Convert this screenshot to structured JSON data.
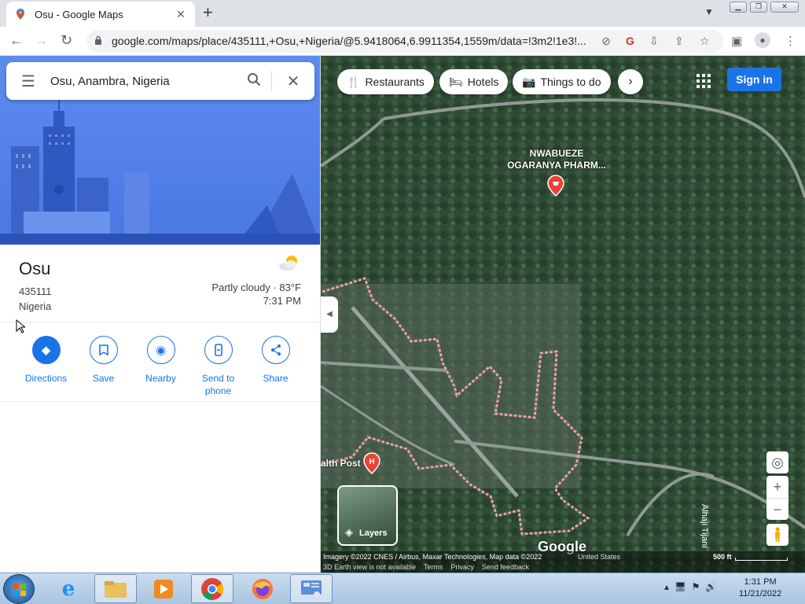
{
  "browser": {
    "tab_title": "Osu - Google Maps",
    "tab_close": "✕",
    "new_tab": "+",
    "url": "google.com/maps/place/435111,+Osu,+Nigeria/@5.9418064,6.9911354,1559m/data=!3m2!1e3!..."
  },
  "search": {
    "query": "Osu, Anambra, Nigeria"
  },
  "place": {
    "name": "Osu",
    "postal_code": "435111",
    "country": "Nigeria"
  },
  "weather": {
    "condition": "Partly cloudy · 83°F",
    "time": "7:31 PM"
  },
  "actions": [
    {
      "label": "Directions",
      "icon": "directions-icon"
    },
    {
      "label": "Save",
      "icon": "bookmark-icon"
    },
    {
      "label": "Nearby",
      "icon": "nearby-icon"
    },
    {
      "label": "Send to\nphone",
      "icon": "send-to-phone-icon"
    },
    {
      "label": "Share",
      "icon": "share-icon"
    }
  ],
  "map": {
    "chips": [
      {
        "label": "Restaurants",
        "icon": "fork-knife-icon"
      },
      {
        "label": "Hotels",
        "icon": "bed-icon"
      },
      {
        "label": "Things to do",
        "icon": "camera-icon"
      }
    ],
    "sign_in": "Sign in",
    "pin_label": "NWABUEZE\nOGARANYA PHARM...",
    "poi_label": "alth Post",
    "road_label": "Alhaji Tijani",
    "layers_label": "Layers",
    "logo": "Google",
    "attribution": "Imagery ©2022 CNES / Airbus, Maxar Technologies, Map data ©2022",
    "region": "United States",
    "footer_links": "3D Earth view is not available    Terms    Privacy    Send feedback",
    "scale": "500 ft",
    "boundary_color": "#e8a0a0"
  },
  "taskbar": {
    "time": "1:31 PM",
    "date": "11/21/2022"
  }
}
